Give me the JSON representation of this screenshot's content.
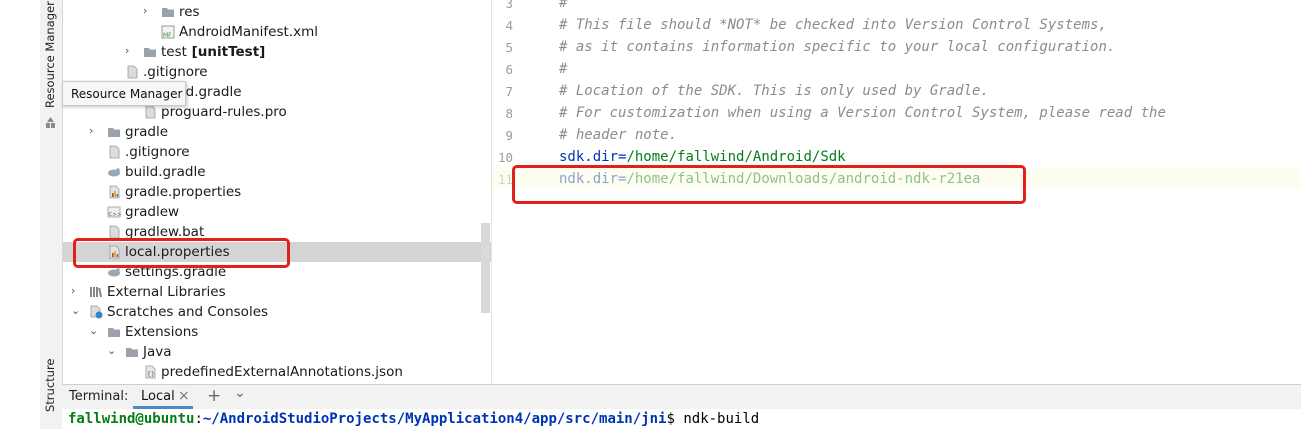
{
  "side_tabs": {
    "resource_manager": "Resource Manager",
    "structure": "Structure"
  },
  "tooltip": "Resource Manager",
  "tree": [
    {
      "label": "res",
      "arrow": "›",
      "icon": "folder"
    },
    {
      "label": "AndroidManifest.xml",
      "arrow": "",
      "icon": "manifest"
    },
    {
      "label": "test",
      "suffix": "[unitTest]",
      "arrow": "›",
      "icon": "folder"
    },
    {
      "label": ".gitignore",
      "arrow": "",
      "icon": "file"
    },
    {
      "label": "build.gradle",
      "arrow": "",
      "icon": "gradle"
    },
    {
      "label": "proguard-rules.pro",
      "arrow": "",
      "icon": "file"
    },
    {
      "label": "gradle",
      "arrow": "›",
      "icon": "folder"
    },
    {
      "label": ".gitignore",
      "arrow": "",
      "icon": "file"
    },
    {
      "label": "build.gradle",
      "arrow": "",
      "icon": "gradle"
    },
    {
      "label": "gradle.properties",
      "arrow": "",
      "icon": "properties"
    },
    {
      "label": "gradlew",
      "arrow": "",
      "icon": "script"
    },
    {
      "label": "gradlew.bat",
      "arrow": "",
      "icon": "file"
    },
    {
      "label": "local.properties",
      "arrow": "",
      "icon": "properties"
    },
    {
      "label": "settings.gradle",
      "arrow": "",
      "icon": "gradle"
    },
    {
      "label": "External Libraries",
      "arrow": "›",
      "icon": "library"
    },
    {
      "label": "Scratches and Consoles",
      "arrow": "⌄",
      "icon": "scratch"
    },
    {
      "label": "Extensions",
      "arrow": "⌄",
      "icon": "folder"
    },
    {
      "label": "Java",
      "arrow": "⌄",
      "icon": "folder"
    },
    {
      "label": "predefinedExternalAnnotations.json",
      "arrow": "",
      "icon": "json"
    }
  ],
  "editor": {
    "lines": [
      {
        "num": "3",
        "text": "#",
        "kind": "comment"
      },
      {
        "num": "4",
        "text": "# This file should *NOT* be checked into Version Control Systems,",
        "kind": "comment"
      },
      {
        "num": "5",
        "text": "# as it contains information specific to your local configuration.",
        "kind": "comment"
      },
      {
        "num": "6",
        "text": "#",
        "kind": "comment"
      },
      {
        "num": "7",
        "text": "# Location of the SDK. This is only used by Gradle.",
        "kind": "comment"
      },
      {
        "num": "8",
        "text": "# For customization when using a Version Control System, please read the",
        "kind": "comment"
      },
      {
        "num": "9",
        "text": "# header note.",
        "kind": "comment"
      },
      {
        "num": "10",
        "key": "sdk.dir",
        "eq": "=",
        "value": "/home/fallwind/Android/Sdk",
        "kind": "prop"
      },
      {
        "num": "11",
        "key": "ndk.dir",
        "eq": "=",
        "value": "/home/fallwind/Downloads/android-ndk-r21ea",
        "kind": "prop"
      }
    ]
  },
  "terminal": {
    "label": "Terminal:",
    "tab": "Local",
    "close": "×",
    "add": "+",
    "more": "⌄",
    "user": "fallwind@ubuntu",
    "sep": ":",
    "path": "~/AndroidStudioProjects/MyApplication4/app/src/main/jni",
    "prompt": "$",
    "command": "ndk-build"
  },
  "colors": {
    "highlight": "#e0201b",
    "selection": "#d4d4d4",
    "prompt_user": "#067d17",
    "prompt_path": "#0033b3"
  }
}
